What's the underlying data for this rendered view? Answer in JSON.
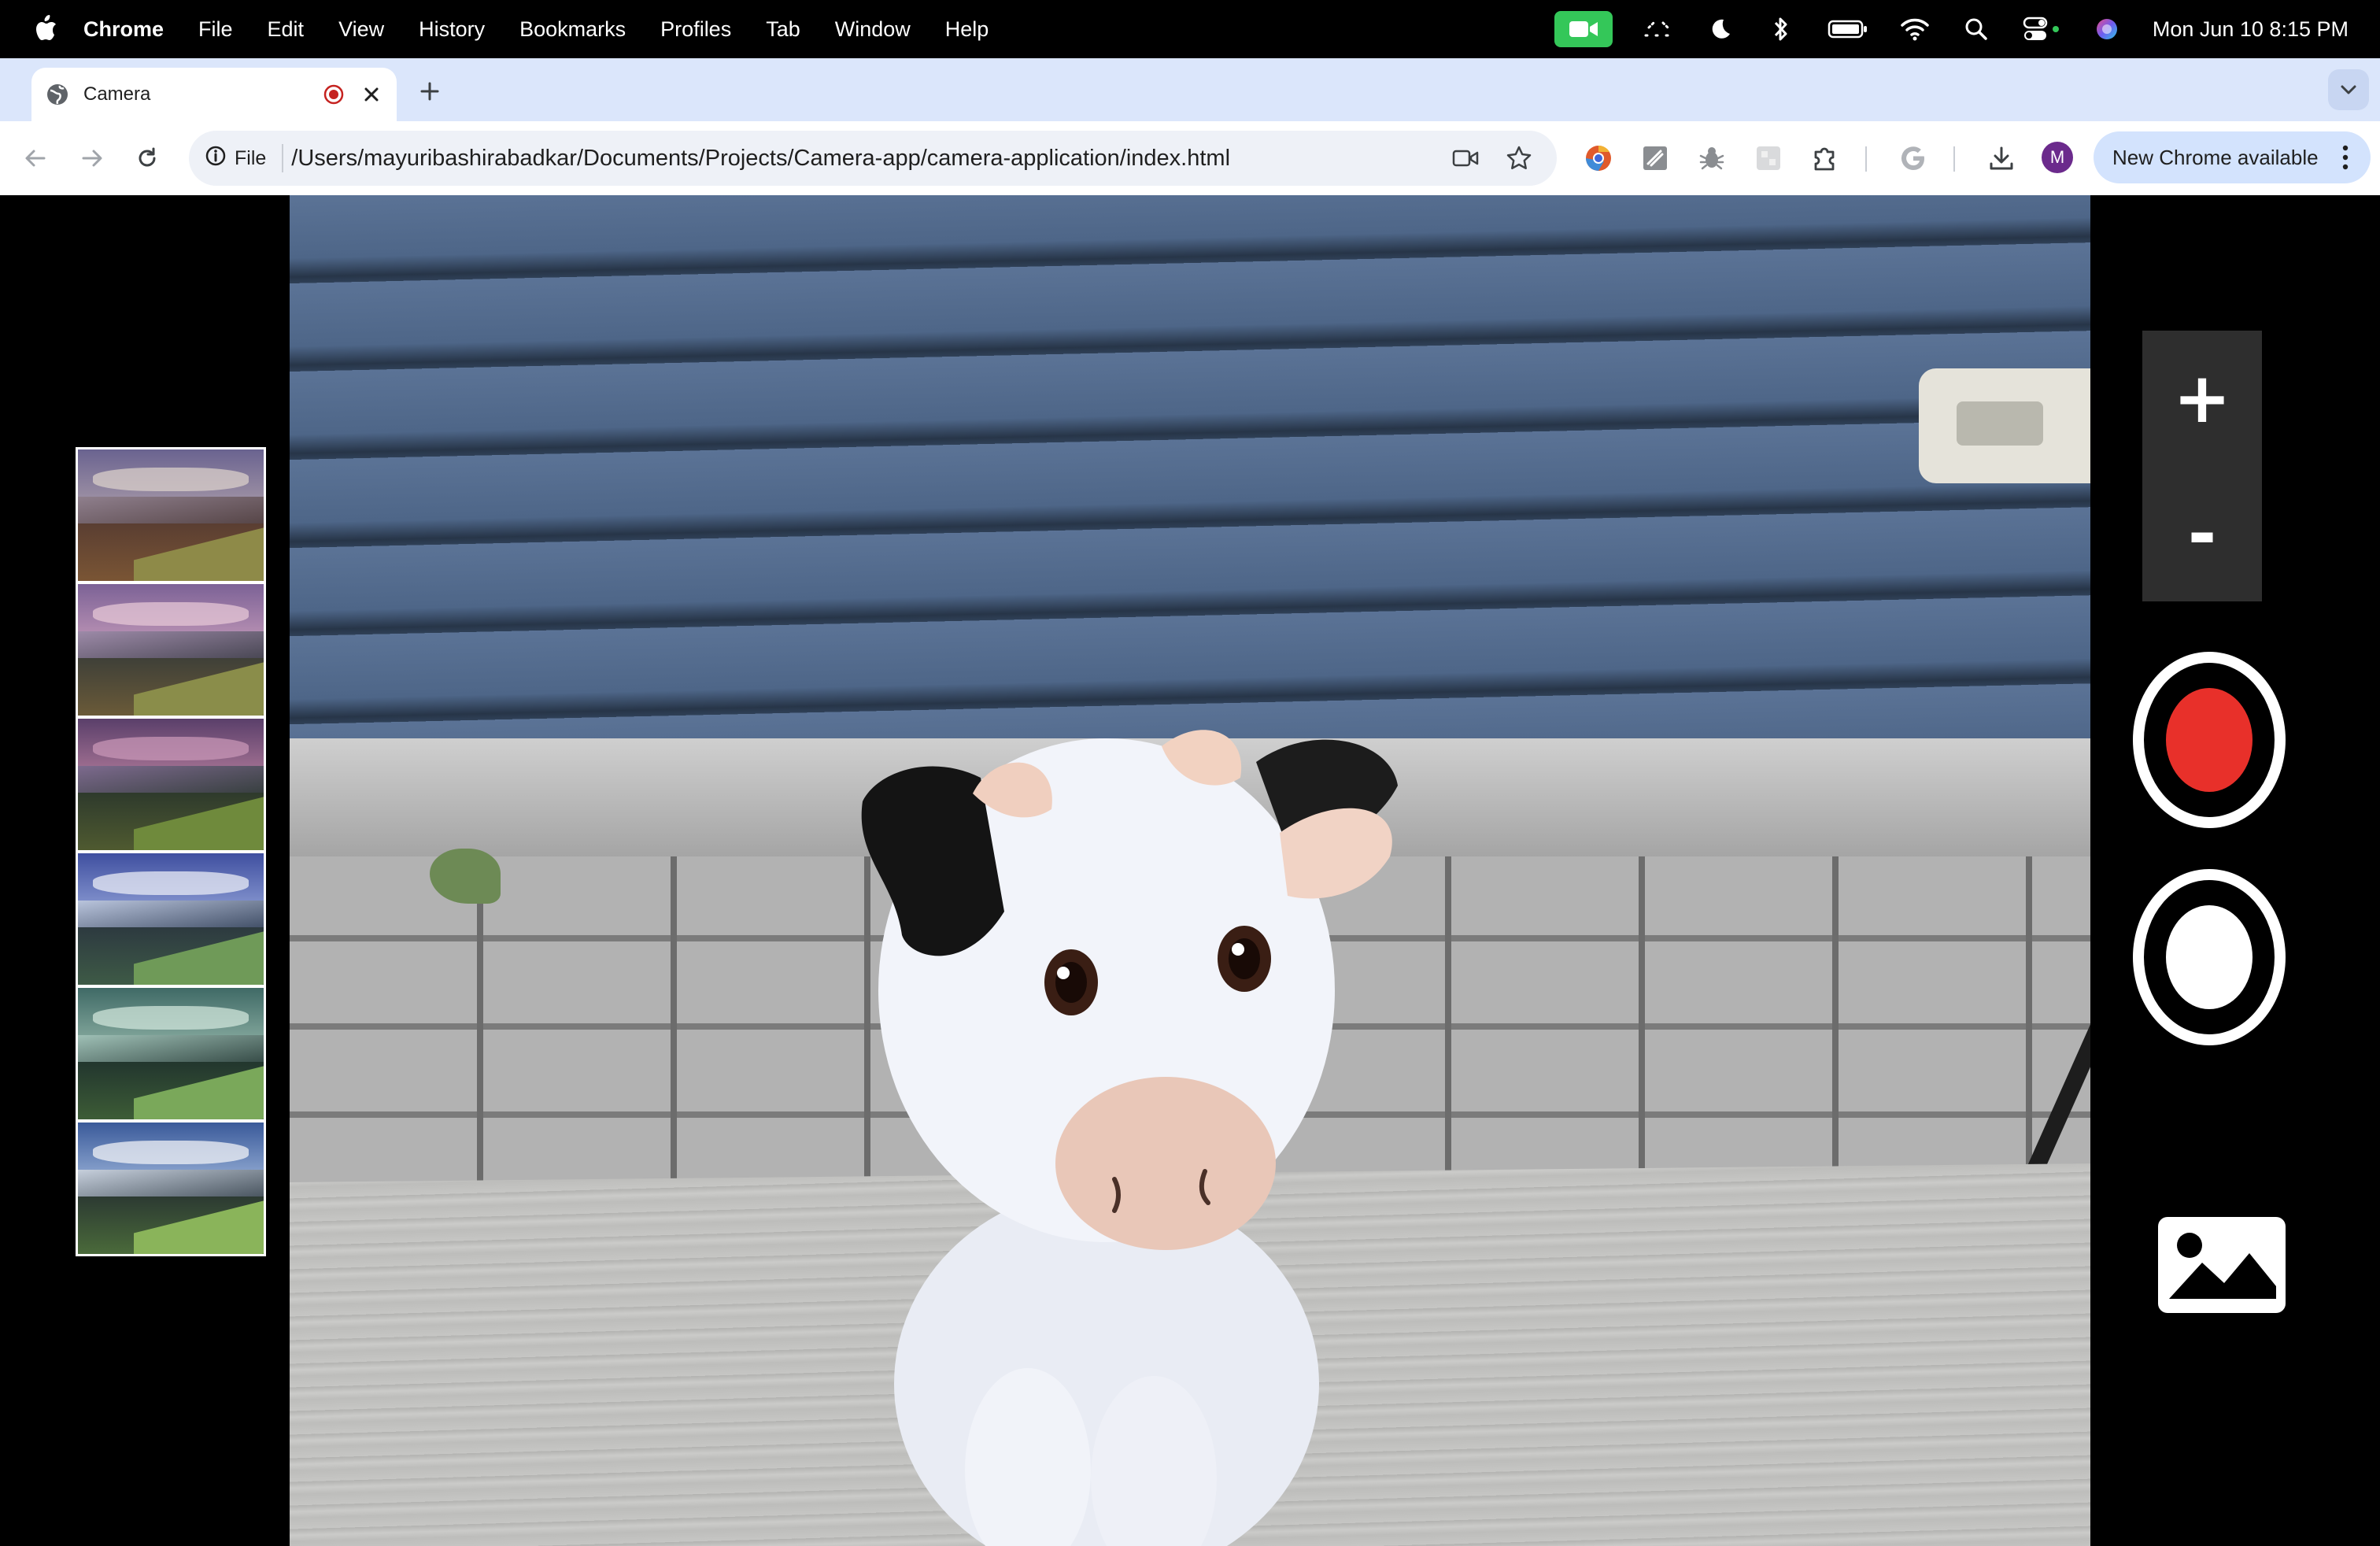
{
  "menubar": {
    "app_name": "Chrome",
    "items": [
      "File",
      "Edit",
      "View",
      "History",
      "Bookmarks",
      "Profiles",
      "Tab",
      "Window",
      "Help"
    ],
    "clock": "Mon Jun 10  8:15 PM",
    "status_icons": [
      "camera-in-use-icon",
      "stage-manager-icon",
      "focus-moon-icon",
      "bluetooth-icon",
      "battery-icon",
      "wifi-icon",
      "spotlight-search-icon",
      "control-center-icon",
      "siri-icon"
    ]
  },
  "tab": {
    "title": "Camera",
    "status_icon": "recording-icon"
  },
  "toolbar": {
    "security_chip": "File",
    "url": "/Users/mayuribashirabadkar/Documents/Projects/Camera-app/camera-application/index.html",
    "profile_initial": "M",
    "update_label": "New Chrome available",
    "extensions": [
      "chromium-ext-icon",
      "scribble-ext-icon",
      "bug-ext-icon",
      "blurred-ext-icon",
      "puzzle-extensions-icon",
      "google-icon"
    ]
  },
  "camera_app": {
    "zoom_in_label": "+",
    "zoom_out_label": "-",
    "thumbnail_filters": [
      "warm-sepia",
      "pink-dusk",
      "violet-dusk",
      "cool-blue",
      "teal",
      "natural"
    ],
    "controls": [
      "record-video",
      "take-photo",
      "open-gallery"
    ],
    "colors": {
      "record": "#e8302a",
      "zoom_panel": "#2e2e2e",
      "background": "#000000"
    }
  }
}
